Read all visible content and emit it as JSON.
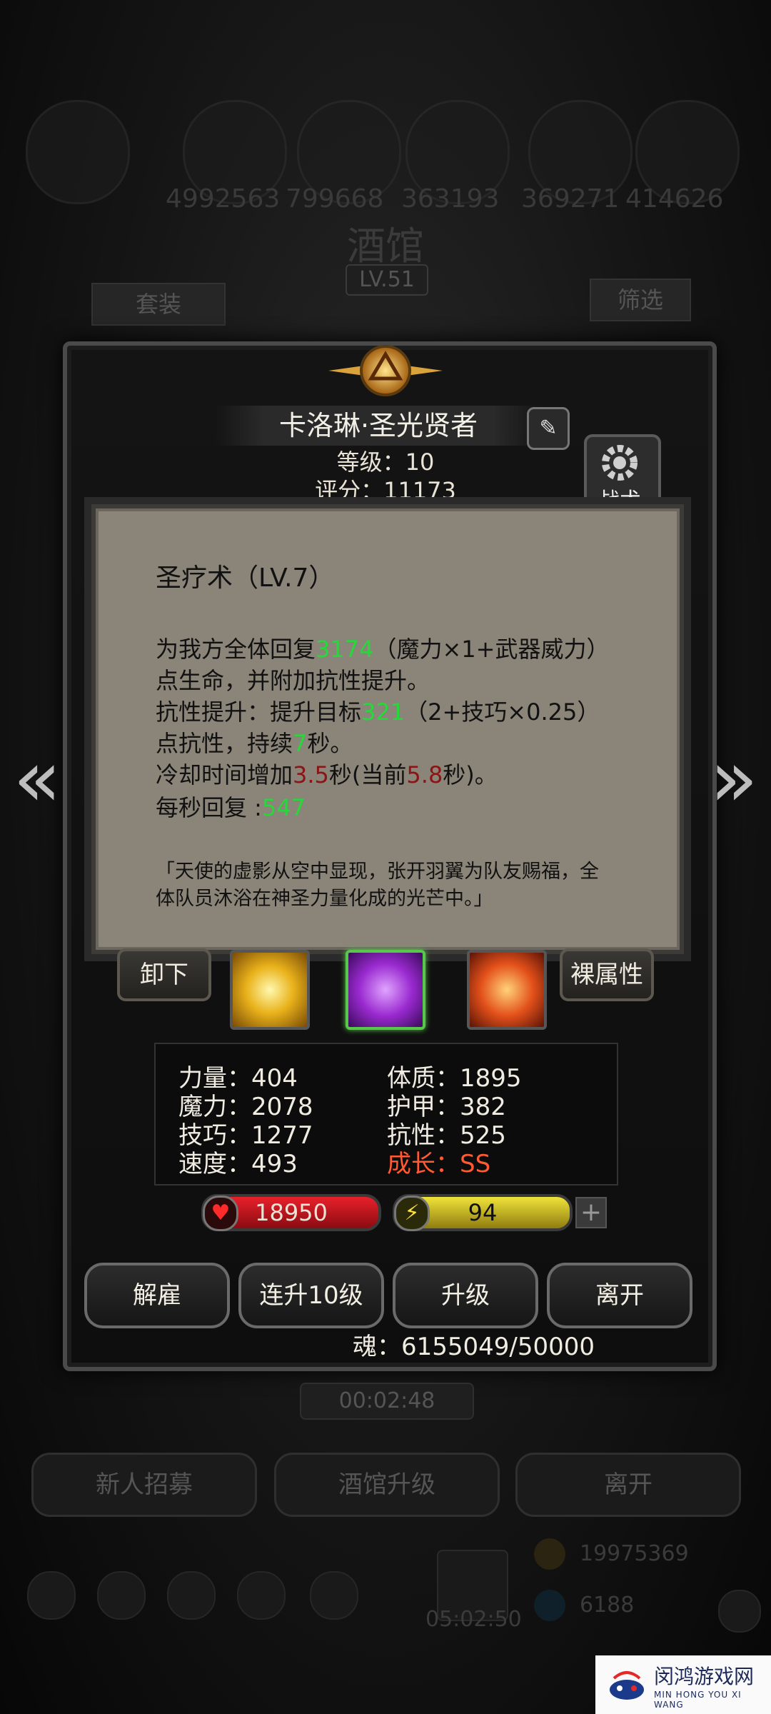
{
  "background": {
    "resources": [
      "4992563",
      "799668",
      "363193",
      "369271",
      "414626"
    ],
    "title": "酒馆",
    "level": "LV.51",
    "tab_left": "套装",
    "tab_right": "筛选",
    "timer": "00:02:48",
    "buttons": [
      "新人招募",
      "酒馆升级",
      "离开"
    ],
    "gold": "19975369",
    "gems": "6188",
    "dock_timer": "05:02:50"
  },
  "hero": {
    "name": "卡洛琳·圣光贤者",
    "level_text": "等级：10",
    "score_text": "评分：11173",
    "tactics_label": "战术"
  },
  "skill_tooltip": {
    "title": "圣疗术（LV.7）",
    "line1_a": "为我方全体回复",
    "line1_v": "3174",
    "line1_b": "（魔力×1+武器威力）",
    "line2": "点生命，并附加抗性提升。",
    "line3_a": "抗性提升：提升目标",
    "line3_v": "321",
    "line3_b": "（2+技巧×0.25）",
    "line4_a": "点抗性，持续",
    "line4_v": "7",
    "line4_b": "秒。",
    "line5_a": "冷却时间增加",
    "line5_v": "3.5",
    "line5_b": "秒(当前",
    "line5_v2": "5.8",
    "line5_c": "秒)。",
    "line6_a": "每秒回复 :",
    "line6_v": "547",
    "quote1": "「天使的虚影从空中显现，张开羽翼为队友赐福，全",
    "quote2": "体队员沐浴在神圣力量化成的光芒中。」"
  },
  "skill_row": {
    "unequip": "卸下",
    "naked_attr": "裸属性"
  },
  "stats": {
    "strength": "力量：404",
    "magic": "魔力：2078",
    "skill": "技巧：1277",
    "speed": "速度：493",
    "constitution": "体质：1895",
    "armor": "护甲：382",
    "resistance": "抗性：525",
    "growth": "成长：SS"
  },
  "bars": {
    "hp": "18950",
    "energy": "94",
    "plus": "+"
  },
  "actions": [
    "解雇",
    "连升10级",
    "升级",
    "离开"
  ],
  "soul": "魂：6155049/50000",
  "watermark": {
    "main": "闵鸿游戏网",
    "sub": "MIN HONG YOU XI WANG"
  },
  "colors": {
    "value_green": "#27d83a",
    "value_red": "#8b1414",
    "growth_orange": "#ff5a32"
  }
}
